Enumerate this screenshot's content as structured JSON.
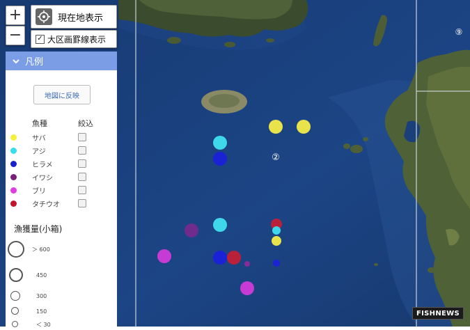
{
  "map_controls": {
    "zoom_in": "+",
    "zoom_out": "−",
    "current_location_label": "現在地表示",
    "show_grid_label": "大区画罫線表示",
    "show_grid_checked": true
  },
  "legend": {
    "title": "凡例",
    "apply_button": "地図に反映",
    "species_header": "魚種",
    "filter_header": "絞込",
    "species": [
      {
        "name": "サバ",
        "color": "#f5f03a"
      },
      {
        "name": "アジ",
        "color": "#35e0ec"
      },
      {
        "name": "ヒラメ",
        "color": "#1b1fd0"
      },
      {
        "name": "イワシ",
        "color": "#7a1f7a"
      },
      {
        "name": "ブリ",
        "color": "#e13be3"
      },
      {
        "name": "タチウオ",
        "color": "#c4142b"
      }
    ],
    "catch_title": "漁獲量(小箱)",
    "sizes": [
      {
        "label": "＞ 600"
      },
      {
        "label": "450"
      },
      {
        "label": "300"
      },
      {
        "label": "150"
      },
      {
        "label": "＜ 30"
      }
    ]
  },
  "map": {
    "area_labels": [
      "②",
      "⑨"
    ],
    "markers": [
      {
        "species": "サバ",
        "color": "#e8e34a"
      },
      {
        "species": "サバ",
        "color": "#e8e34a"
      },
      {
        "species": "アジ",
        "color": "#3fd7ea"
      },
      {
        "species": "ヒラメ",
        "color": "#1b22d6"
      },
      {
        "species": "アジ",
        "color": "#3fd7ea"
      },
      {
        "species": "イワシ",
        "color": "#6f2c8c"
      },
      {
        "species": "タチウオ",
        "color": "#b9203a"
      },
      {
        "species": "アジ",
        "color": "#3fd7ea"
      },
      {
        "species": "サバ",
        "color": "#e8e34a"
      },
      {
        "species": "ブリ",
        "color": "#c53bd4"
      },
      {
        "species": "ヒラメ",
        "color": "#1b22d6"
      },
      {
        "species": "タチウオ",
        "color": "#b9203a"
      },
      {
        "species": "イワシ",
        "color": "#8a2a9a"
      },
      {
        "species": "ヒラメ",
        "color": "#1b22d6"
      },
      {
        "species": "ブリ",
        "color": "#c53bd4"
      }
    ]
  },
  "watermark": "FISHNEWS"
}
